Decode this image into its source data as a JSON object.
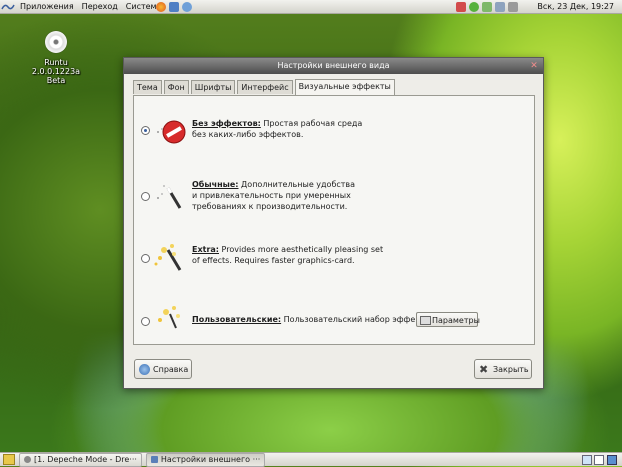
{
  "top_panel": {
    "menus": [
      "Приложения",
      "Переход",
      "Система"
    ],
    "clock": "Вск, 23 Дек, 19:27"
  },
  "desktop": {
    "icon_label": "Runtu 2.0.0.1223a Beta"
  },
  "dialog": {
    "title": "Настройки внешнего вида",
    "tabs": [
      "Тема",
      "Фон",
      "Шрифты",
      "Интерфейс",
      "Визуальные эффекты"
    ],
    "active_tab": "Визуальные эффекты",
    "options": [
      {
        "name": "Без эффектов:",
        "desc_line1": "Простая рабочая среда",
        "desc_line2": "без каких-либо эффектов.",
        "desc_line3": "",
        "selected": true
      },
      {
        "name": "Обычные:",
        "desc_line1": "Дополнительные удобства",
        "desc_line2": "и привлекательность при умеренных",
        "desc_line3": "требованиях к производительности.",
        "selected": false
      },
      {
        "name": "Extra:",
        "desc_line1": "Provides more aesthetically pleasing set",
        "desc_line2": "of effects. Requires faster graphics-card.",
        "desc_line3": "",
        "selected": false
      },
      {
        "name": "Пользовательские:",
        "desc_line1": "Пользовательский набор эффектов.",
        "desc_line2": "",
        "desc_line3": "",
        "selected": false
      }
    ],
    "params_button": "Параметры",
    "help_button": "Справка",
    "close_button": "Закрыть"
  },
  "taskbar": {
    "tasks": [
      "[1. Depeche Mode - Dre···",
      "Настройки внешнего ···"
    ]
  },
  "colors": {
    "titlebar": "#4d4d4d",
    "dialog_bg": "#eeede8",
    "panel_bg": "#e4e3dd",
    "accent": "#3a5f9e"
  }
}
